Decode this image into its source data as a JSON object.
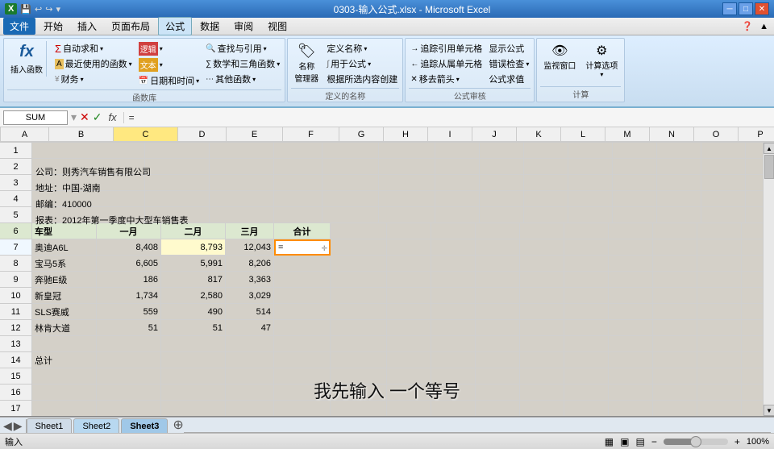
{
  "titlebar": {
    "title": "0303-输入公式.xlsx - Microsoft Excel",
    "controls": [
      "minimize",
      "restore",
      "close"
    ]
  },
  "menubar": {
    "items": [
      "文件",
      "开始",
      "插入",
      "页面布局",
      "公式",
      "数据",
      "审阅",
      "视图"
    ]
  },
  "ribbon": {
    "active_tab": "公式",
    "groups": [
      {
        "label": "函数库",
        "buttons": [
          {
            "label": "插入函数",
            "icon": "fx"
          },
          {
            "label": "自动求和▾",
            "icon": "Σ"
          },
          {
            "label": "最近使用的函数▾"
          },
          {
            "label": "财务▾"
          },
          {
            "label": "逻辑▾"
          },
          {
            "label": "文本▾"
          },
          {
            "label": "日期和时间▾"
          },
          {
            "label": "其他函数▾"
          },
          {
            "label": "查找与引用▾"
          },
          {
            "label": "数学和三角函数▾"
          }
        ]
      },
      {
        "label": "定义的名称",
        "buttons": [
          {
            "label": "名称管理器"
          },
          {
            "label": "定义名称▾"
          },
          {
            "label": "用于公式▾"
          },
          {
            "label": "根据所选内容创建"
          }
        ]
      },
      {
        "label": "公式审核",
        "buttons": [
          {
            "label": "追踪引用单元格"
          },
          {
            "label": "追踪从属单元格"
          },
          {
            "label": "移去箭头▾"
          },
          {
            "label": "显示公式"
          },
          {
            "label": "错误检查▾"
          },
          {
            "label": "公式求值"
          }
        ]
      },
      {
        "label": "计算",
        "buttons": [
          {
            "label": "监视窗口"
          },
          {
            "label": "计算选项▾"
          }
        ]
      }
    ]
  },
  "formulabar": {
    "name_box": "SUM",
    "checkmark": "✓",
    "cross": "✗",
    "fx_label": "fx",
    "formula": "="
  },
  "columns": [
    "A",
    "B",
    "C",
    "D",
    "E",
    "F",
    "G",
    "H",
    "I",
    "J",
    "K",
    "L",
    "M",
    "N",
    "O",
    "P"
  ],
  "rows": [
    {
      "num": 1,
      "cells": {
        "A": "公司：则秀汽车销售有限公司"
      }
    },
    {
      "num": 2,
      "cells": {
        "A": "地址：中国-湖南"
      }
    },
    {
      "num": 3,
      "cells": {
        "A": "邮编：410000"
      }
    },
    {
      "num": 4,
      "cells": {
        "A": "报表：2012年第一季度中大型车销售表"
      }
    },
    {
      "num": 5,
      "cells": {}
    },
    {
      "num": 6,
      "cells": {
        "A": "车型",
        "B": "一月",
        "C": "二月",
        "D": "三月",
        "E": "合计"
      },
      "header": true
    },
    {
      "num": 7,
      "cells": {
        "A": "奥迪A6L",
        "B": "8,408",
        "C": "8,793",
        "D": "12,043",
        "E": "="
      },
      "active_e": true
    },
    {
      "num": 8,
      "cells": {
        "A": "宝马5系",
        "B": "6,605",
        "C": "5,991",
        "D": "8,206"
      }
    },
    {
      "num": 9,
      "cells": {
        "A": "奔驰E级",
        "B": "186",
        "C": "817",
        "D": "3,363"
      }
    },
    {
      "num": 10,
      "cells": {
        "A": "新皇冠",
        "B": "1,734",
        "C": "2,580",
        "D": "3,029"
      }
    },
    {
      "num": 11,
      "cells": {
        "A": "SLS赛威",
        "B": "559",
        "C": "490",
        "D": "514"
      }
    },
    {
      "num": 12,
      "cells": {
        "A": "林肯大道",
        "B": "51",
        "C": "51",
        "D": "47"
      }
    },
    {
      "num": 13,
      "cells": {}
    },
    {
      "num": 14,
      "cells": {
        "A": "总计"
      }
    },
    {
      "num": 15,
      "cells": {}
    },
    {
      "num": 16,
      "cells": {}
    },
    {
      "num": 17,
      "cells": {}
    }
  ],
  "sheettabs": {
    "tabs": [
      "Sheet1",
      "Sheet2",
      "Sheet3"
    ],
    "active": "Sheet2",
    "highlighted": "Sheet3"
  },
  "statusbar": {
    "mode": "输入",
    "zoom": "100%"
  },
  "subtitle": "我先输入 一个等号"
}
